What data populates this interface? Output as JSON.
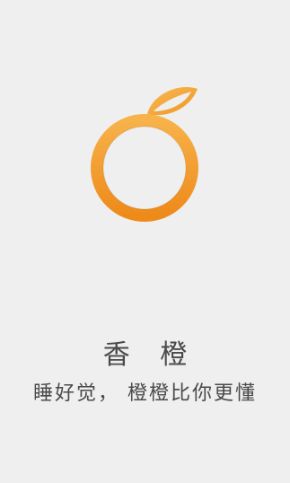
{
  "app": {
    "name": "香 橙",
    "tagline": "睡好觉， 橙橙比你更懂"
  },
  "logo": {
    "icon": "orange-icon",
    "colors": {
      "ring_light": "#f7b24a",
      "ring_dark": "#ee8a1a",
      "leaf": "#f3a23a"
    }
  },
  "background_color": "#efefef"
}
